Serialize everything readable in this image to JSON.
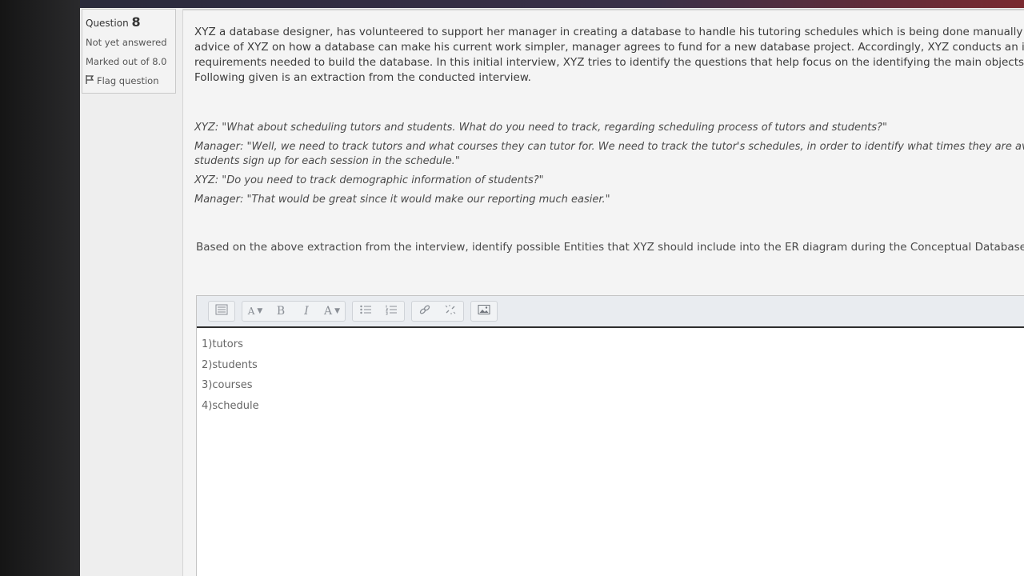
{
  "question_info": {
    "label": "Question",
    "number": "8",
    "status": "Not yet answered",
    "marks": "Marked out of 8.0",
    "flag": "Flag question"
  },
  "question_text": [
    "XYZ a database designer, has volunteered to support her manager in creating a database to handle his tutoring schedules which is being done manually at",
    "advice of XYZ on how a database can make his current work simpler, manager agrees to fund for a new database project. Accordingly, XYZ conducts an inte",
    "requirements needed to build the database. In this initial interview, XYZ tries to identify the questions that help focus on the identifying the main objects of",
    "Following given is an extraction from the conducted interview."
  ],
  "interview": [
    "XYZ: \"What about scheduling tutors and students. What do you need to track, regarding scheduling   process of tutors and students?\"",
    "Manager: \"Well, we need to track tutors and what courses they can tutor for. We need to track the tutor's schedules, in order to identify what times they are available",
    "students sign up for each session in the schedule.\"",
    "XYZ: \"Do you need to track demographic information of students?\"",
    "Manager: \"That would be great since it would make our reporting much easier.\""
  ],
  "prompt": "Based on the above extraction from the interview, identify possible Entities that XYZ should include into the ER diagram during the Conceptual Database Desi",
  "toolbar": {
    "icons": [
      "toolbar-toggle-icon",
      "paragraph-styles-icon",
      "bold-icon",
      "italic-icon",
      "font-color-icon",
      "unordered-list-icon",
      "ordered-list-icon",
      "link-icon",
      "unlink-icon",
      "image-icon"
    ],
    "bold": "B",
    "italic": "I",
    "font_color": "A",
    "styles": "A"
  },
  "answer_lines": [
    "1)tutors",
    "2)students",
    "3)courses",
    "4)schedule"
  ],
  "colors": {
    "page_bg": "#eeeeee",
    "editor_bg": "#ffffff",
    "toolbar_bg": "#e9ecf0",
    "text": "#3c3c3c"
  }
}
